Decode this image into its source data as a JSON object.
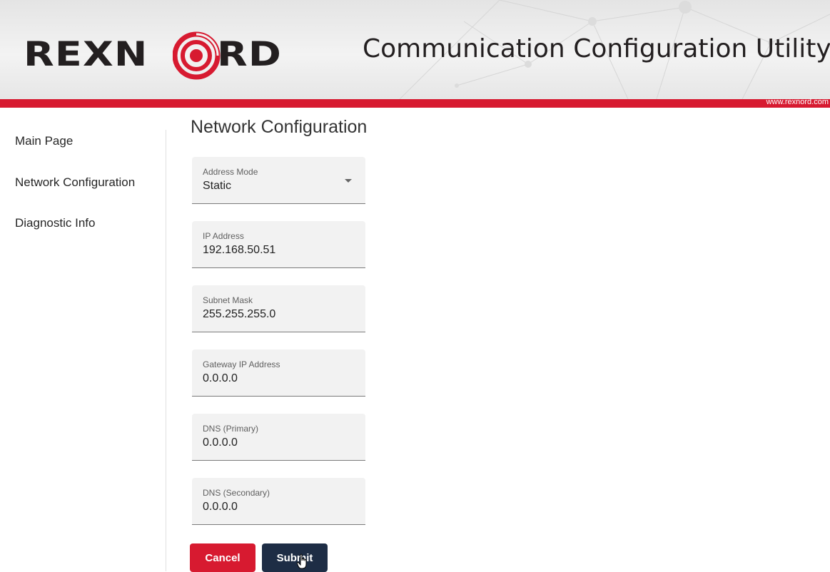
{
  "header": {
    "logo_text_left": "REXN",
    "logo_text_right": "RD",
    "title": "Communication Configuration Utility",
    "url": "www.rexnord.com"
  },
  "sidebar": {
    "items": [
      {
        "label": "Main Page"
      },
      {
        "label": "Network Configuration"
      },
      {
        "label": "Diagnostic Info"
      }
    ]
  },
  "main": {
    "title": "Network Configuration",
    "fields": [
      {
        "label": "Address Mode",
        "value": "Static"
      },
      {
        "label": "IP Address",
        "value": "192.168.50.51"
      },
      {
        "label": "Subnet Mask",
        "value": "255.255.255.0"
      },
      {
        "label": "Gateway IP Address",
        "value": "0.0.0.0"
      },
      {
        "label": "DNS (Primary)",
        "value": "0.0.0.0"
      },
      {
        "label": "DNS (Secondary)",
        "value": "0.0.0.0"
      }
    ],
    "buttons": {
      "cancel": "Cancel",
      "submit": "Submit"
    }
  },
  "colors": {
    "brand_red": "#d71a30",
    "submit_navy": "#1e2d45",
    "field_bg": "#f2f2f2"
  },
  "icons": {
    "dropdown": "chevron-down-icon",
    "cursor": "hand-pointer-icon"
  }
}
